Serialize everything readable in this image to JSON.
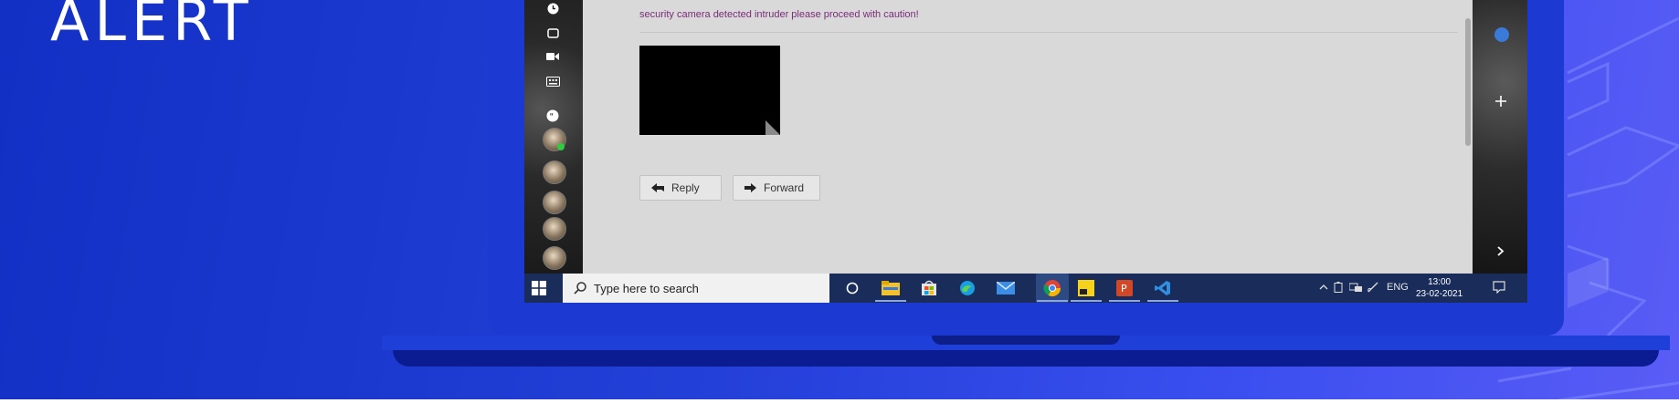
{
  "headline": "ALERT",
  "email": {
    "message": "security camera detected intruder please proceed with caution!",
    "reply_label": "Reply",
    "forward_label": "Forward"
  },
  "taskbar": {
    "search_placeholder": "Type here to search",
    "language": "ENG",
    "time": "13:00",
    "date": "23-02-2021",
    "pinned_apps": [
      "task-view",
      "file-explorer",
      "microsoft-store",
      "edge",
      "mail",
      "chrome",
      "sticky-notes",
      "powerpoint",
      "vscode"
    ]
  },
  "colors": {
    "background": "#2340d8",
    "message_text": "#7b2a7a",
    "taskbar": "#1a2d5a",
    "laptop": "#1c3ad2"
  }
}
